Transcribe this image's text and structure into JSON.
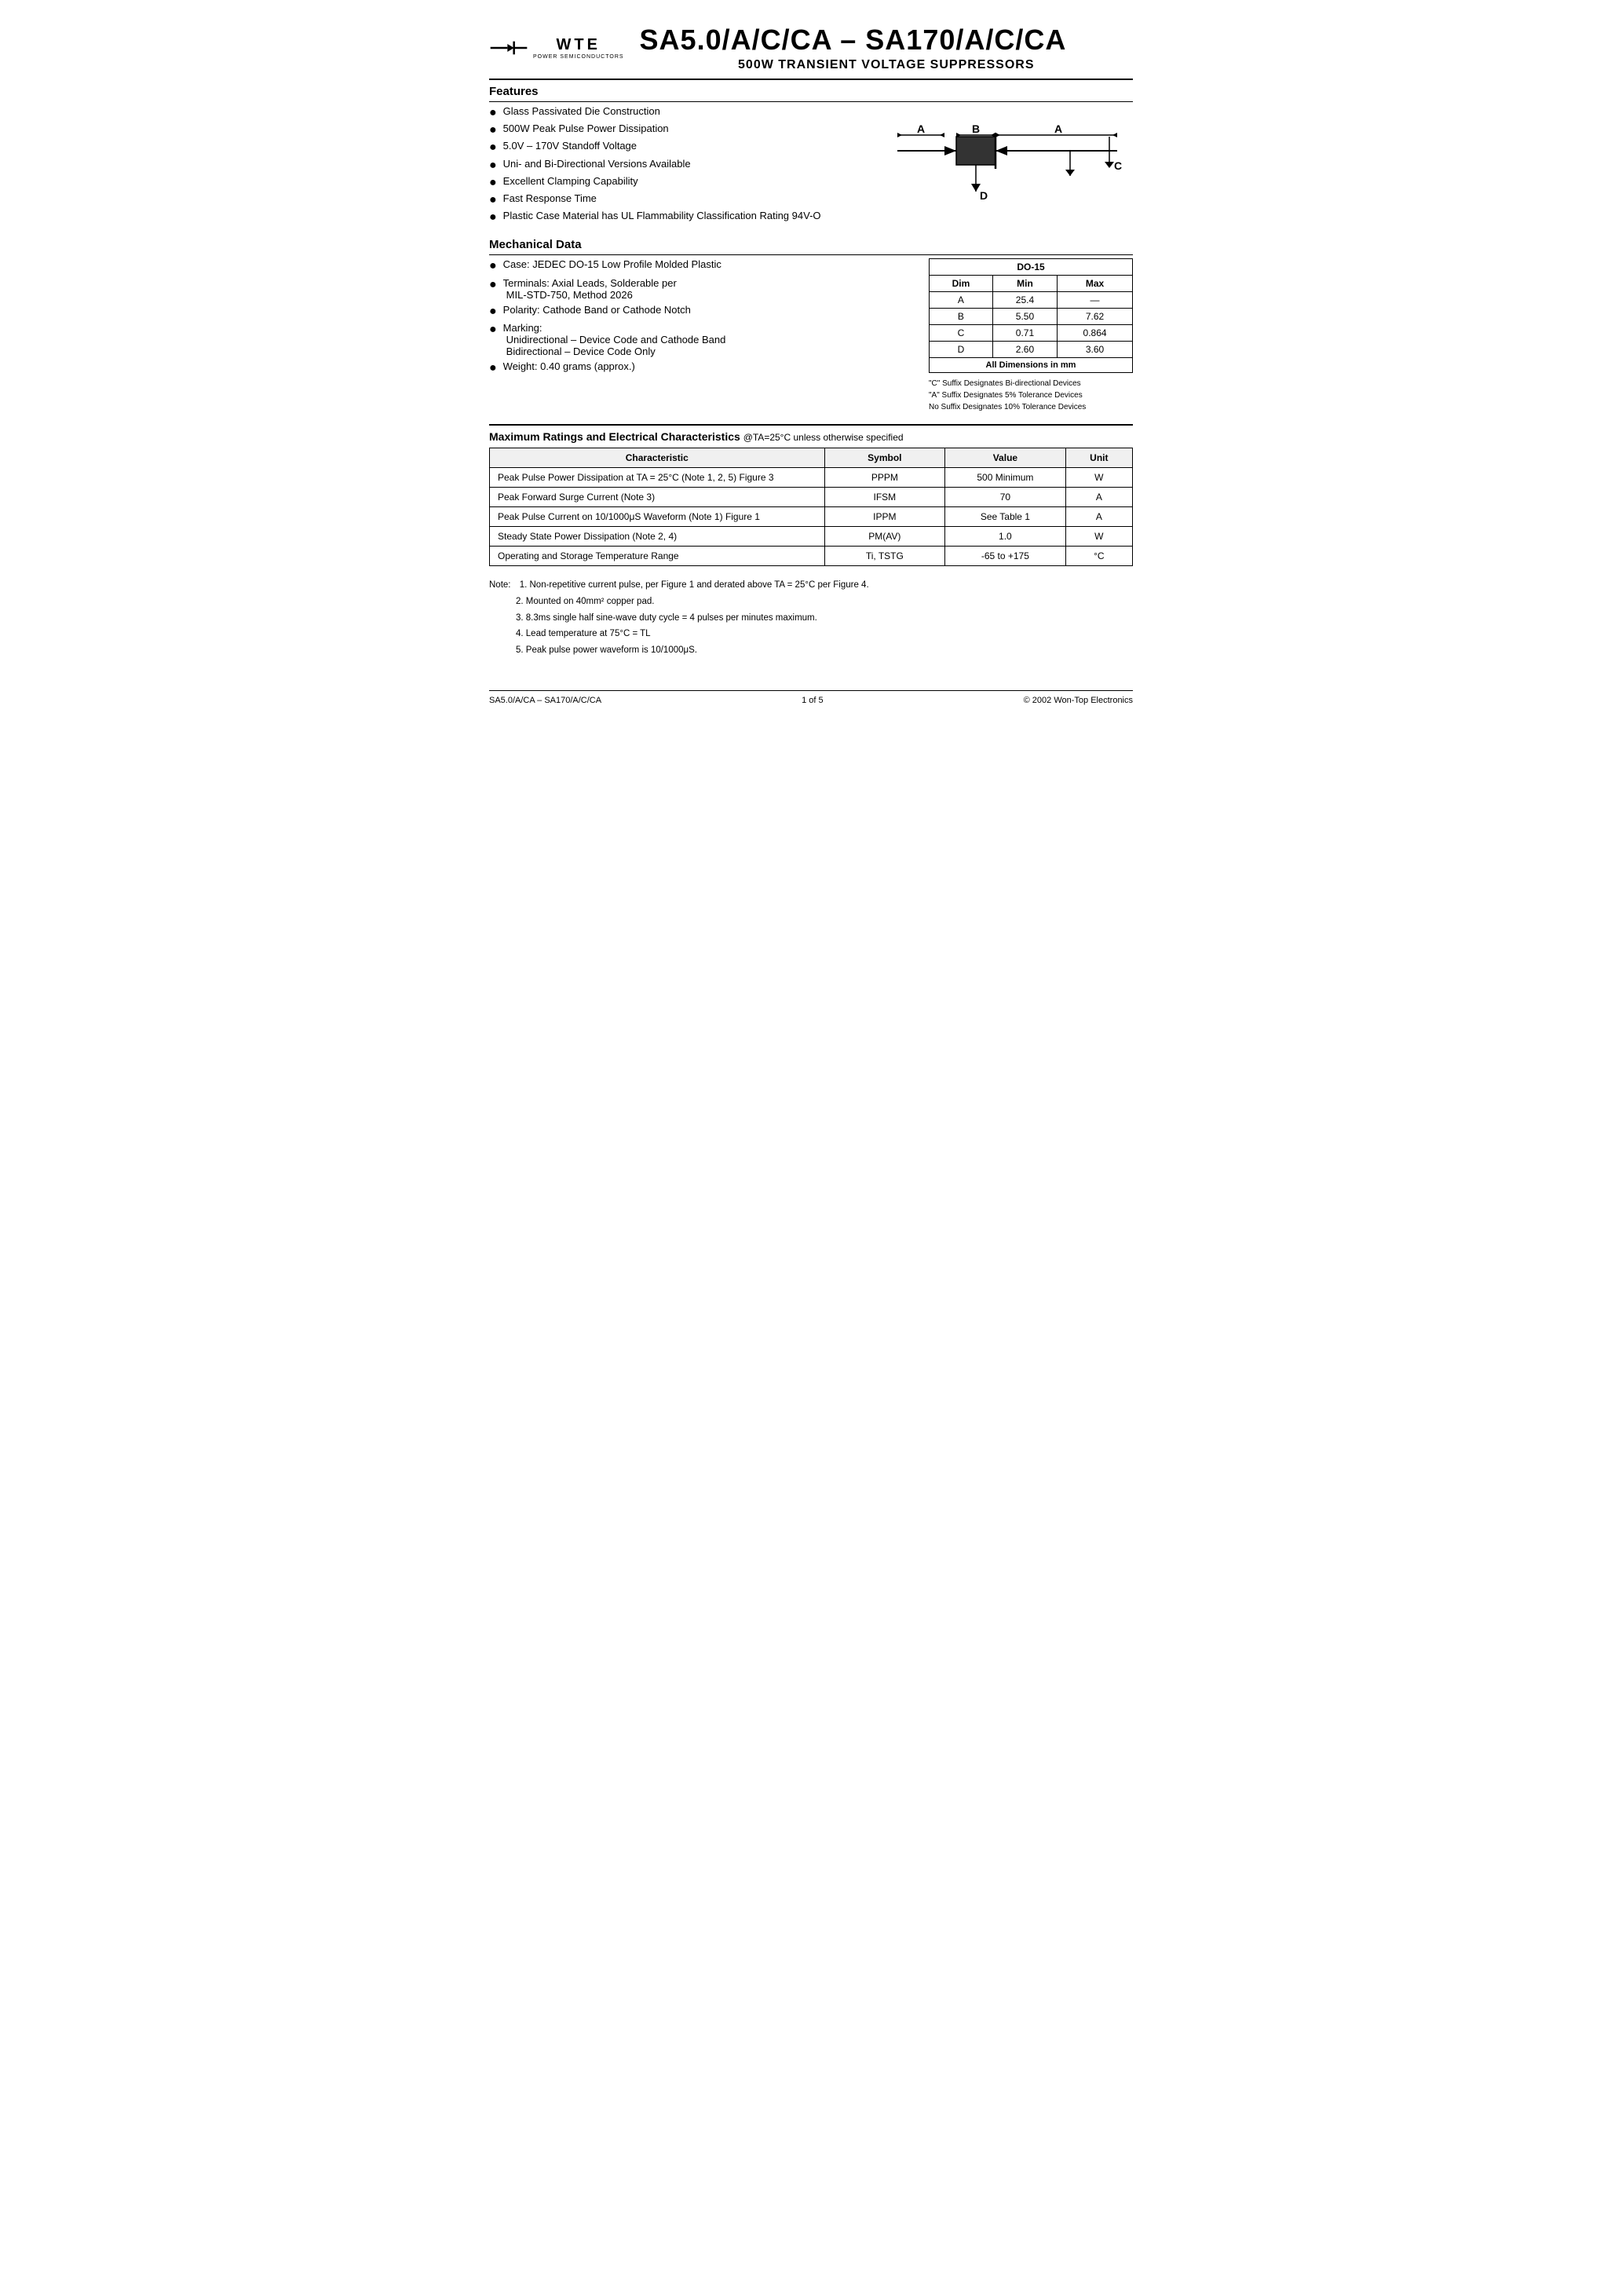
{
  "header": {
    "main_title": "SA5.0/A/C/CA – SA170/A/C/CA",
    "subtitle": "500W TRANSIENT VOLTAGE SUPPRESSORS",
    "logo_wte": "WTE",
    "logo_subtitle": "POWER SEMICONDUCTORS"
  },
  "features": {
    "section_title": "Features",
    "items": [
      "Glass Passivated Die Construction",
      "500W Peak Pulse Power Dissipation",
      "5.0V – 170V Standoff Voltage",
      "Uni- and Bi-Directional Versions Available",
      "Excellent Clamping Capability",
      "Fast Response Time",
      "Plastic Case Material has UL Flammability Classification Rating 94V-O"
    ]
  },
  "mechanical": {
    "section_title": "Mechanical Data",
    "items": [
      {
        "main": "Case: JEDEC DO-15 Low Profile Molded Plastic",
        "sub": ""
      },
      {
        "main": "Terminals: Axial Leads, Solderable per",
        "sub": "MIL-STD-750, Method 2026"
      },
      {
        "main": "Polarity: Cathode Band or Cathode Notch",
        "sub": ""
      },
      {
        "main": "Marking:",
        "sub": ""
      },
      {
        "main": "",
        "sub": "Unidirectional – Device Code and Cathode Band"
      },
      {
        "main": "",
        "sub": "Bidirectional – Device Code Only"
      },
      {
        "main": "Weight: 0.40 grams (approx.)",
        "sub": ""
      }
    ]
  },
  "do15_table": {
    "title": "DO-15",
    "headers": [
      "Dim",
      "Min",
      "Max"
    ],
    "rows": [
      [
        "A",
        "25.4",
        "—"
      ],
      [
        "B",
        "5.50",
        "7.62"
      ],
      [
        "C",
        "0.71",
        "0.864"
      ],
      [
        "D",
        "2.60",
        "3.60"
      ]
    ],
    "footer": "All Dimensions in mm",
    "suffix_notes": [
      "\"C\" Suffix Designates Bi-directional Devices",
      "\"A\" Suffix Designates 5% Tolerance Devices",
      "No Suffix Designates 10% Tolerance Devices"
    ]
  },
  "ratings": {
    "section_title": "Maximum Ratings and Electrical Characteristics",
    "condition": "@TA=25°C unless otherwise specified",
    "headers": [
      "Characteristic",
      "Symbol",
      "Value",
      "Unit"
    ],
    "rows": [
      {
        "characteristic": "Peak Pulse Power Dissipation at TA = 25°C (Note 1, 2, 5) Figure 3",
        "symbol": "PPPM",
        "value": "500 Minimum",
        "unit": "W"
      },
      {
        "characteristic": "Peak Forward Surge Current (Note 3)",
        "symbol": "IFSM",
        "value": "70",
        "unit": "A"
      },
      {
        "characteristic": "Peak Pulse Current on 10/1000μS Waveform (Note 1) Figure 1",
        "symbol": "IPPM",
        "value": "See Table 1",
        "unit": "A"
      },
      {
        "characteristic": "Steady State Power Dissipation (Note 2, 4)",
        "symbol": "PM(AV)",
        "value": "1.0",
        "unit": "W"
      },
      {
        "characteristic": "Operating and Storage Temperature Range",
        "symbol": "Ti, TSTG",
        "value": "-65 to +175",
        "unit": "°C"
      }
    ]
  },
  "notes": {
    "header": "Note:",
    "items": [
      "1. Non-repetitive current pulse, per Figure 1 and derated above TA = 25°C per Figure 4.",
      "2. Mounted on 40mm² copper pad.",
      "3. 8.3ms single half sine-wave duty cycle = 4 pulses per minutes maximum.",
      "4. Lead temperature at 75°C = TL",
      "5. Peak pulse power waveform is 10/1000μS."
    ]
  },
  "footer": {
    "left": "SA5.0/A/CA – SA170/A/C/CA",
    "center": "1 of 5",
    "right": "© 2002 Won-Top Electronics"
  }
}
